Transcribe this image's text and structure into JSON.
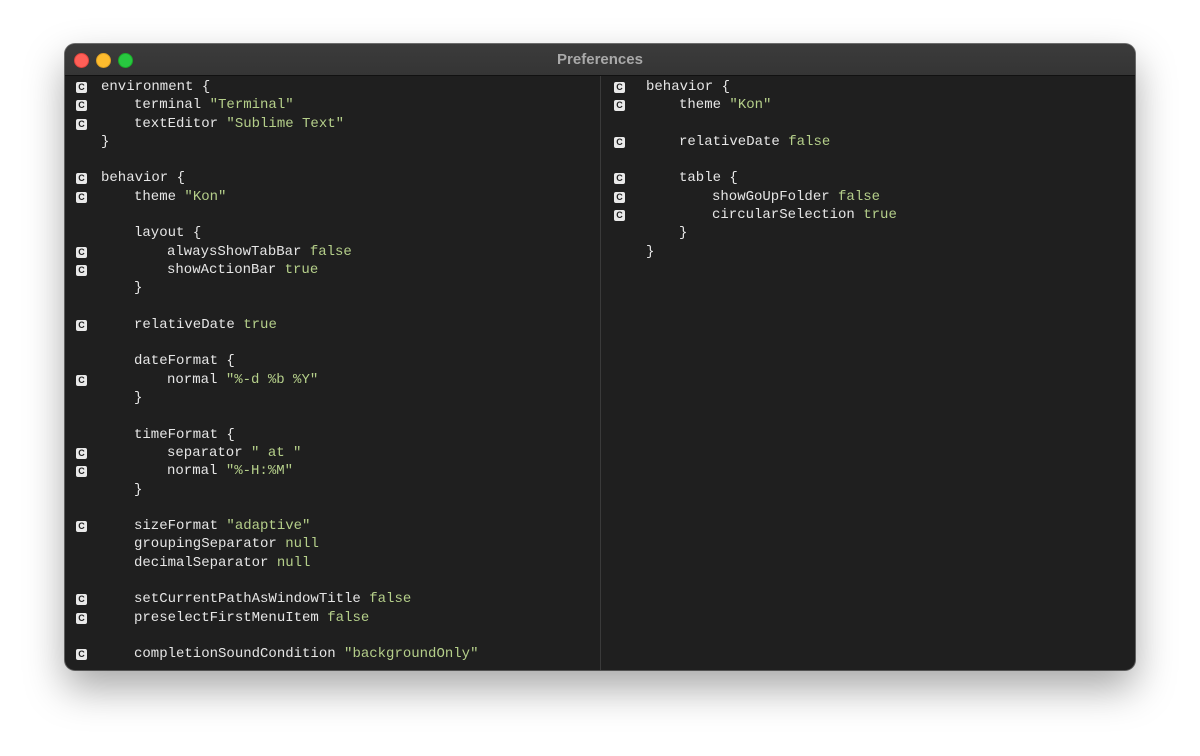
{
  "window": {
    "title": "Preferences"
  },
  "gutter_marker": "C",
  "left_pane": {
    "lines": [
      {
        "indent": 0,
        "key": "environment",
        "value": "{",
        "value_kind": "plain",
        "marker": true
      },
      {
        "indent": 1,
        "key": "terminal",
        "value": "\"Terminal\"",
        "value_kind": "literal",
        "marker": true
      },
      {
        "indent": 1,
        "key": "textEditor",
        "value": "\"Sublime Text\"",
        "value_kind": "literal",
        "marker": true
      },
      {
        "indent": 0,
        "key": "}",
        "value": "",
        "value_kind": "plain",
        "marker": false
      },
      {
        "indent": 0,
        "key": "",
        "value": "",
        "value_kind": "plain",
        "marker": false
      },
      {
        "indent": 0,
        "key": "behavior",
        "value": "{",
        "value_kind": "plain",
        "marker": true
      },
      {
        "indent": 1,
        "key": "theme",
        "value": "\"Kon\"",
        "value_kind": "literal",
        "marker": true
      },
      {
        "indent": 0,
        "key": "",
        "value": "",
        "value_kind": "plain",
        "marker": false
      },
      {
        "indent": 1,
        "key": "layout",
        "value": "{",
        "value_kind": "plain",
        "marker": false
      },
      {
        "indent": 2,
        "key": "alwaysShowTabBar",
        "value": "false",
        "value_kind": "literal",
        "marker": true
      },
      {
        "indent": 2,
        "key": "showActionBar",
        "value": "true",
        "value_kind": "literal",
        "marker": true
      },
      {
        "indent": 1,
        "key": "}",
        "value": "",
        "value_kind": "plain",
        "marker": false
      },
      {
        "indent": 0,
        "key": "",
        "value": "",
        "value_kind": "plain",
        "marker": false
      },
      {
        "indent": 1,
        "key": "relativeDate",
        "value": "true",
        "value_kind": "literal",
        "marker": true
      },
      {
        "indent": 0,
        "key": "",
        "value": "",
        "value_kind": "plain",
        "marker": false
      },
      {
        "indent": 1,
        "key": "dateFormat",
        "value": "{",
        "value_kind": "plain",
        "marker": false
      },
      {
        "indent": 2,
        "key": "normal",
        "value": "\"%-d %b %Y\"",
        "value_kind": "literal",
        "marker": true
      },
      {
        "indent": 1,
        "key": "}",
        "value": "",
        "value_kind": "plain",
        "marker": false
      },
      {
        "indent": 0,
        "key": "",
        "value": "",
        "value_kind": "plain",
        "marker": false
      },
      {
        "indent": 1,
        "key": "timeFormat",
        "value": "{",
        "value_kind": "plain",
        "marker": false
      },
      {
        "indent": 2,
        "key": "separator",
        "value": "\" at \"",
        "value_kind": "literal",
        "marker": true
      },
      {
        "indent": 2,
        "key": "normal",
        "value": "\"%-H:%M\"",
        "value_kind": "literal",
        "marker": true
      },
      {
        "indent": 1,
        "key": "}",
        "value": "",
        "value_kind": "plain",
        "marker": false
      },
      {
        "indent": 0,
        "key": "",
        "value": "",
        "value_kind": "plain",
        "marker": false
      },
      {
        "indent": 1,
        "key": "sizeFormat",
        "value": "\"adaptive\"",
        "value_kind": "literal",
        "marker": true
      },
      {
        "indent": 1,
        "key": "groupingSeparator",
        "value": "null",
        "value_kind": "literal",
        "marker": false
      },
      {
        "indent": 1,
        "key": "decimalSeparator",
        "value": "null",
        "value_kind": "literal",
        "marker": false
      },
      {
        "indent": 0,
        "key": "",
        "value": "",
        "value_kind": "plain",
        "marker": false
      },
      {
        "indent": 1,
        "key": "setCurrentPathAsWindowTitle",
        "value": "false",
        "value_kind": "literal",
        "marker": true
      },
      {
        "indent": 1,
        "key": "preselectFirstMenuItem",
        "value": "false",
        "value_kind": "literal",
        "marker": true
      },
      {
        "indent": 0,
        "key": "",
        "value": "",
        "value_kind": "plain",
        "marker": false
      },
      {
        "indent": 1,
        "key": "completionSoundCondition",
        "value": "\"backgroundOnly\"",
        "value_kind": "literal",
        "marker": true
      }
    ]
  },
  "right_pane": {
    "lines": [
      {
        "indent": 0,
        "key": "behavior",
        "value": "{",
        "value_kind": "plain",
        "marker": true
      },
      {
        "indent": 1,
        "key": "theme",
        "value": "\"Kon\"",
        "value_kind": "literal",
        "marker": true
      },
      {
        "indent": 0,
        "key": "",
        "value": "",
        "value_kind": "plain",
        "marker": false
      },
      {
        "indent": 1,
        "key": "relativeDate",
        "value": "false",
        "value_kind": "literal",
        "marker": true
      },
      {
        "indent": 0,
        "key": "",
        "value": "",
        "value_kind": "plain",
        "marker": false
      },
      {
        "indent": 1,
        "key": "table",
        "value": "{",
        "value_kind": "plain",
        "marker": true
      },
      {
        "indent": 2,
        "key": "showGoUpFolder",
        "value": "false",
        "value_kind": "literal",
        "marker": true
      },
      {
        "indent": 2,
        "key": "circularSelection",
        "value": "true",
        "value_kind": "literal",
        "marker": true
      },
      {
        "indent": 1,
        "key": "}",
        "value": "",
        "value_kind": "plain",
        "marker": false
      },
      {
        "indent": 0,
        "key": "}",
        "value": "",
        "value_kind": "plain",
        "marker": false
      }
    ]
  },
  "colors": {
    "background": "#1f1f1f",
    "text": "#e6e6e6",
    "value": "#b5cf8a"
  }
}
